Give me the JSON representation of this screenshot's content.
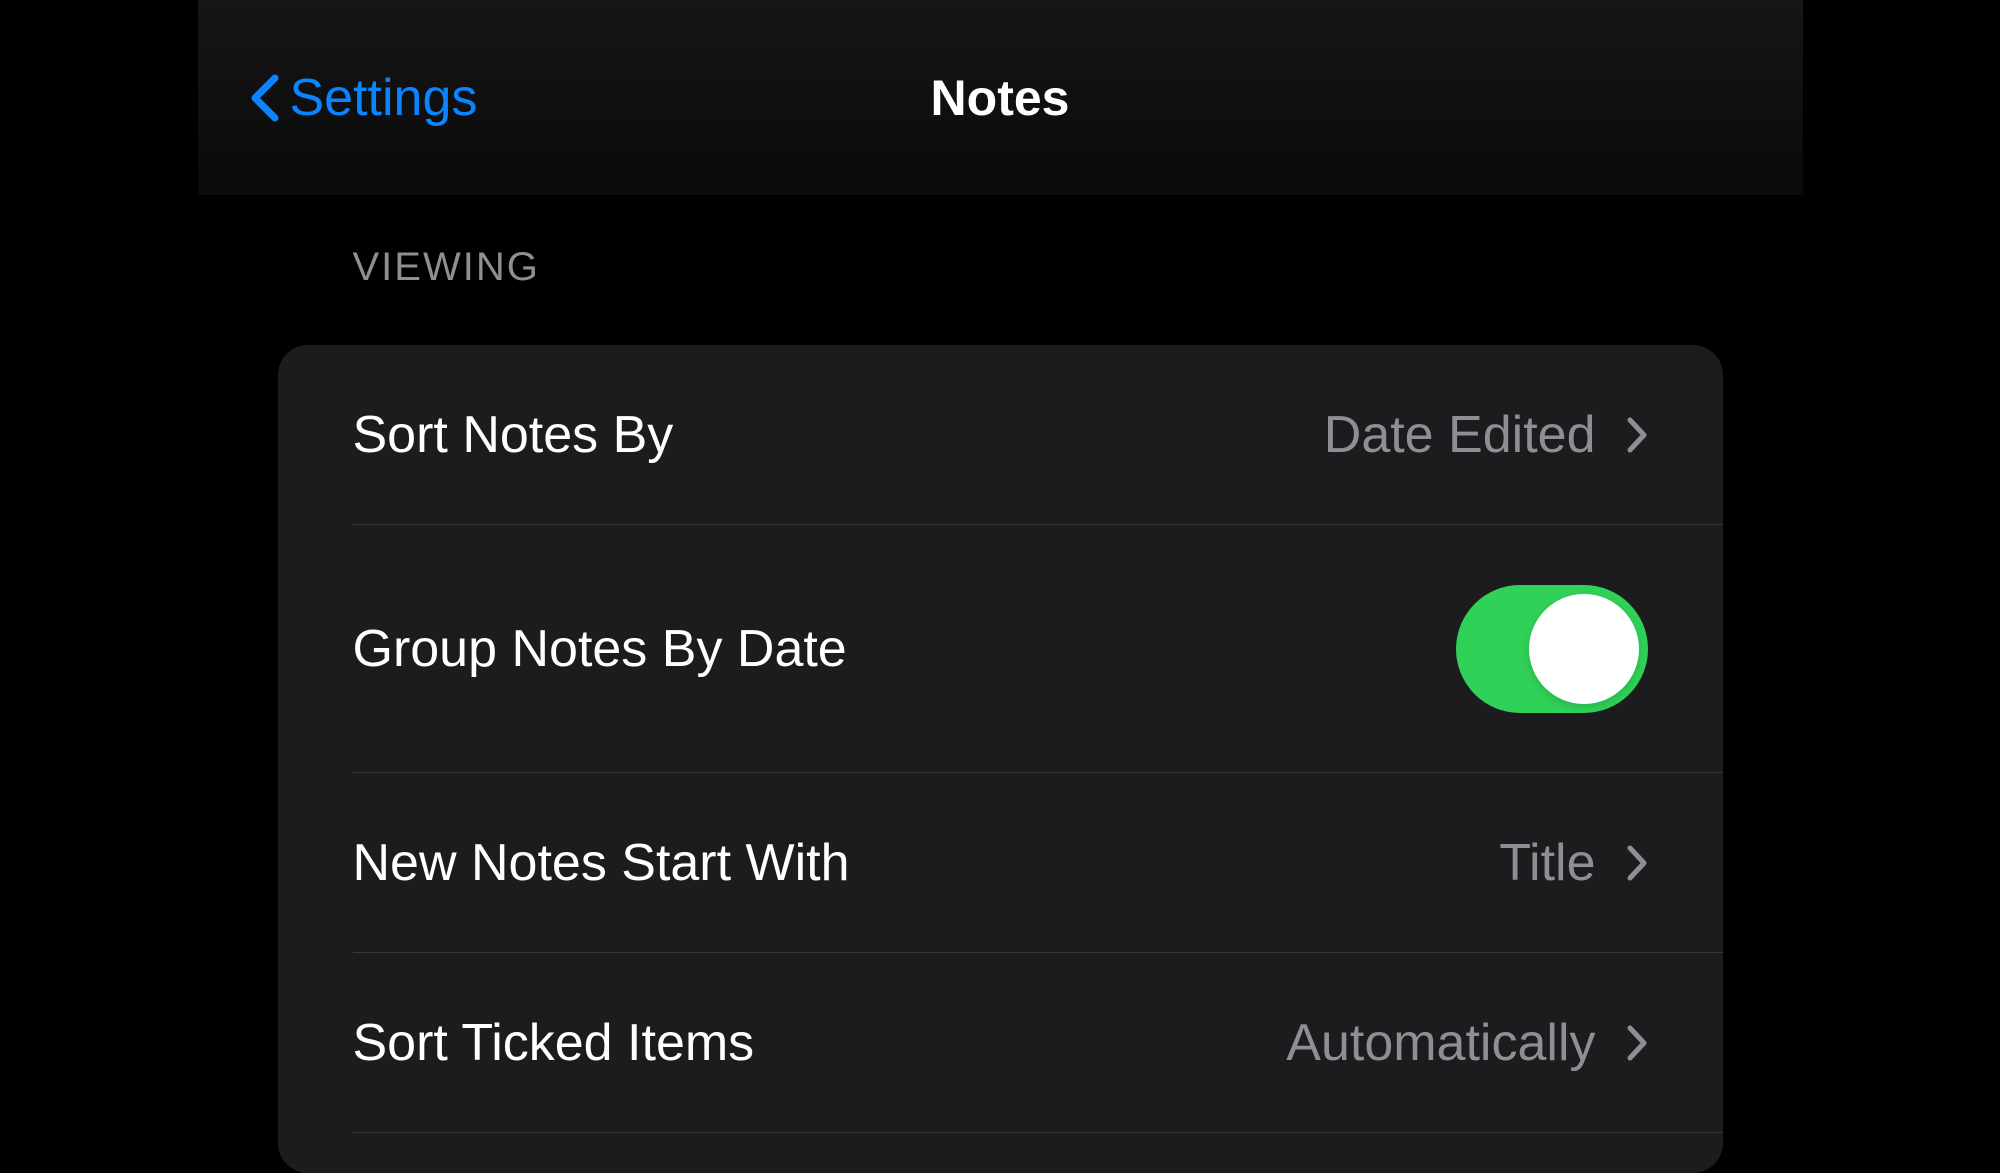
{
  "nav": {
    "back_label": "Settings",
    "title": "Notes"
  },
  "section": {
    "header": "VIEWING"
  },
  "rows": {
    "sort_notes_by": {
      "label": "Sort Notes By",
      "value": "Date Edited"
    },
    "group_by_date": {
      "label": "Group Notes By Date",
      "toggle_on": true
    },
    "new_notes_start": {
      "label": "New Notes Start With",
      "value": "Title"
    },
    "sort_ticked": {
      "label": "Sort Ticked Items",
      "value": "Automatically"
    }
  },
  "colors": {
    "accent": "#0A84FF",
    "toggle_on": "#30D158",
    "background": "#000000",
    "cell_background": "#1C1C1E",
    "text_primary": "#FFFFFF",
    "text_secondary": "#8E8E93"
  }
}
